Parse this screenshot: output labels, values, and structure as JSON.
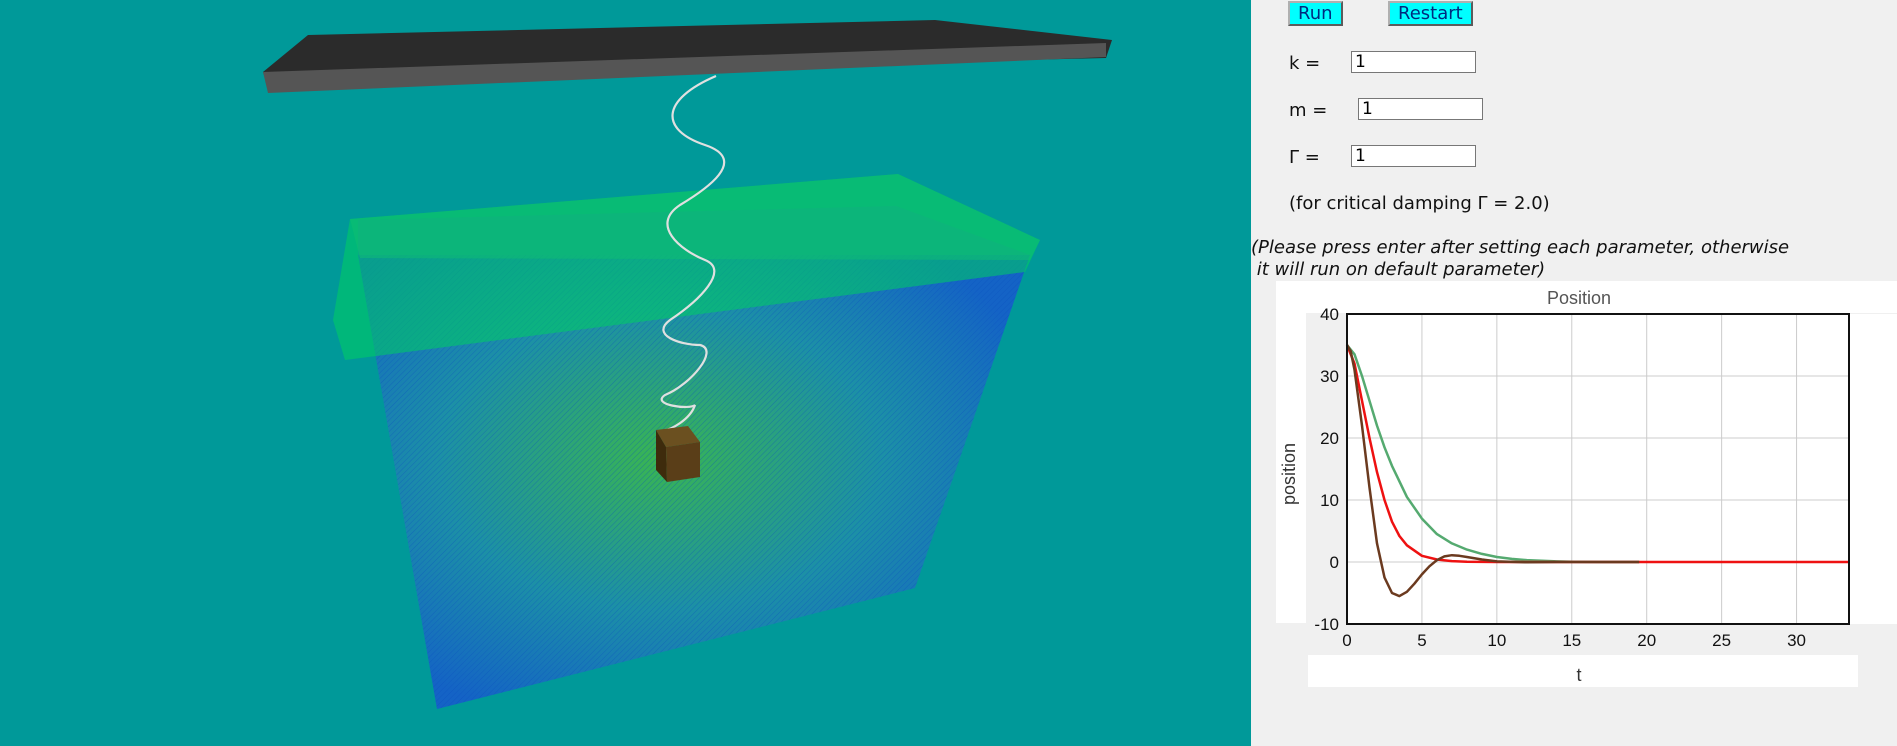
{
  "controls": {
    "run_label": "Run",
    "restart_label": "Restart",
    "k_label": "k =",
    "k_value": "1",
    "m_label": "m =",
    "m_value": "1",
    "gamma_label": "Γ =",
    "gamma_value": "1",
    "critical_note": "(for critical damping Γ = 2.0)",
    "instruction_line1": "(Please press enter after setting each parameter, otherwise",
    "instruction_line2": " it will run on default parameter)"
  },
  "colors": {
    "scene_background": "#009999",
    "panel_background": "#f0f0f0",
    "button_background": "#00ffff",
    "ceiling": "#2e2e2e",
    "tank_water": "#1560c8",
    "tank_rim": "#00d060",
    "block": "#5a3e18"
  },
  "chart_data": {
    "type": "line",
    "title": "Position",
    "xlabel": "t",
    "ylabel": "position",
    "xlim": [
      0,
      33.5
    ],
    "ylim": [
      -10,
      40
    ],
    "x_ticks": [
      0,
      5,
      10,
      15,
      20,
      25,
      30
    ],
    "y_ticks": [
      -10,
      0,
      10,
      20,
      30,
      40
    ],
    "grid": true,
    "series": [
      {
        "color": "#55aa70",
        "x": [
          0,
          0.5,
          1,
          1.5,
          2,
          2.5,
          3,
          4,
          5,
          6,
          7,
          8,
          9,
          10,
          11,
          12,
          13,
          14,
          15,
          17,
          19.5
        ],
        "y": [
          35,
          33.5,
          30,
          26,
          22,
          18.5,
          15.5,
          10.5,
          7,
          4.5,
          3,
          2,
          1.3,
          0.8,
          0.5,
          0.3,
          0.2,
          0.1,
          0.05,
          0,
          0
        ]
      },
      {
        "color": "#ee1111",
        "x": [
          0,
          0.5,
          1,
          1.5,
          2,
          2.5,
          3,
          3.5,
          4,
          5,
          6,
          7,
          8,
          10,
          12,
          33.5
        ],
        "y": [
          35,
          32,
          26,
          20,
          14.5,
          10,
          6.5,
          4.2,
          2.7,
          1,
          0.4,
          0.15,
          0.05,
          0,
          0,
          0
        ]
      },
      {
        "color": "#6b3a1f",
        "x": [
          0,
          0.25,
          0.5,
          1,
          1.5,
          2,
          2.5,
          3,
          3.5,
          4,
          4.5,
          5,
          5.5,
          6,
          6.5,
          7,
          7.5,
          8,
          9,
          10,
          12,
          14,
          16,
          19.5
        ],
        "y": [
          35,
          34,
          31,
          22,
          12,
          3,
          -2.5,
          -5,
          -5.5,
          -4.8,
          -3.5,
          -2,
          -0.7,
          0.3,
          0.9,
          1.1,
          1.0,
          0.8,
          0.4,
          0.1,
          -0.05,
          0,
          0,
          0
        ]
      }
    ]
  }
}
